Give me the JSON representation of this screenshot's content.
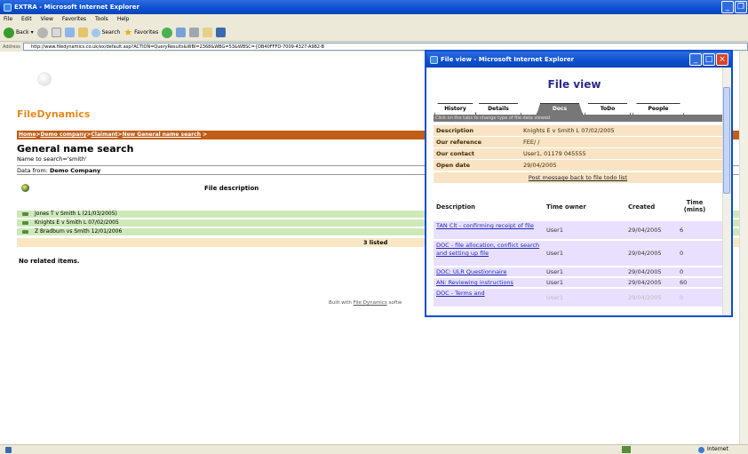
{
  "browser": {
    "title": "EXTRA - Microsoft Internet Explorer",
    "menu": [
      "File",
      "Edit",
      "View",
      "Favorites",
      "Tools",
      "Help"
    ],
    "toolbar": {
      "back": "Back",
      "search": "Search",
      "favorites": "Favorites"
    },
    "address_label": "Address",
    "address_value": "http://www.filedynamics.co.uk/ex/default.asp?ACTION=QueryResults&WBI=2368&WBG=53&WBSC={DB40FFFD-7009-4327-A982-B",
    "status_right": "Internet"
  },
  "page": {
    "logo": "FileDynamics",
    "breadcrumb": [
      "Home",
      "Demo company",
      "Claimant",
      "New General name search"
    ],
    "title": "General name search",
    "search_desc": "Name to search='smith'",
    "data_from_label": "Data from:",
    "data_from_value": "Demo Company",
    "column_header": "File description",
    "rows": [
      "Jones T v Smith L (21/03/2005)",
      "Knights E v Smith L 07/02/2005",
      "Z Bradburn vs Smith 12/01/2006"
    ],
    "listed": "3 listed",
    "no_related": "No related items.",
    "built_with": "Built with",
    "built_with_link": "File Dynamics",
    "built_with_suffix": "softw"
  },
  "popup": {
    "title": "File view - Microsoft Internet Explorer",
    "heading": "File view",
    "tabs": [
      "History",
      "Details",
      "Docs",
      "ToDo",
      "People"
    ],
    "tab_hint": "Click on the tabs to change type of file data viewed",
    "info": [
      {
        "label": "Description",
        "value": "Knights E v Smith L 07/02/2005"
      },
      {
        "label": "Our reference",
        "value": "FEE/ /"
      },
      {
        "label": "Our contact",
        "value": "User1, 01179 045555"
      },
      {
        "label": "Open date",
        "value": "29/04/2005"
      }
    ],
    "post_message": "Post message back to file todo list",
    "docs_headers": [
      "Description",
      "Time owner",
      "Created",
      "Time (mins)"
    ],
    "docs": [
      {
        "desc": "TAN Clt - confirming receipt of file",
        "owner": "User1",
        "created": "29/04/2005",
        "time": "6"
      },
      {
        "desc": "DOC - file allocation, conflict search and setting up file",
        "owner": "User1",
        "created": "29/04/2005",
        "time": "0"
      },
      {
        "desc": "DOC: ULR Questionnaire",
        "owner": "User1",
        "created": "29/04/2005",
        "time": "0"
      },
      {
        "desc": "AN: Reviewing instructions",
        "owner": "User1",
        "created": "29/04/2005",
        "time": "60"
      },
      {
        "desc": "DOC - Terms and",
        "owner": "User1",
        "created": "29/04/2005",
        "time": "0"
      }
    ]
  }
}
